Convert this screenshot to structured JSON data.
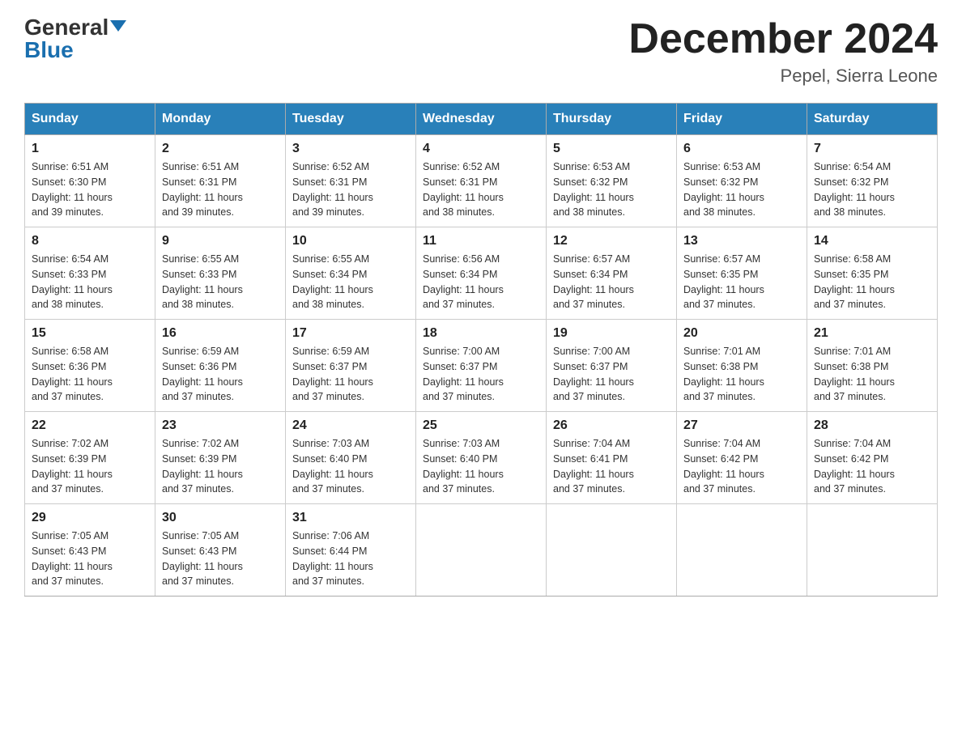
{
  "header": {
    "logo_general": "General",
    "logo_blue": "Blue",
    "title": "December 2024",
    "subtitle": "Pepel, Sierra Leone"
  },
  "days_of_week": [
    "Sunday",
    "Monday",
    "Tuesday",
    "Wednesday",
    "Thursday",
    "Friday",
    "Saturday"
  ],
  "weeks": [
    [
      {
        "day": "1",
        "sunrise": "6:51 AM",
        "sunset": "6:30 PM",
        "daylight": "11 hours and 39 minutes."
      },
      {
        "day": "2",
        "sunrise": "6:51 AM",
        "sunset": "6:31 PM",
        "daylight": "11 hours and 39 minutes."
      },
      {
        "day": "3",
        "sunrise": "6:52 AM",
        "sunset": "6:31 PM",
        "daylight": "11 hours and 39 minutes."
      },
      {
        "day": "4",
        "sunrise": "6:52 AM",
        "sunset": "6:31 PM",
        "daylight": "11 hours and 38 minutes."
      },
      {
        "day": "5",
        "sunrise": "6:53 AM",
        "sunset": "6:32 PM",
        "daylight": "11 hours and 38 minutes."
      },
      {
        "day": "6",
        "sunrise": "6:53 AM",
        "sunset": "6:32 PM",
        "daylight": "11 hours and 38 minutes."
      },
      {
        "day": "7",
        "sunrise": "6:54 AM",
        "sunset": "6:32 PM",
        "daylight": "11 hours and 38 minutes."
      }
    ],
    [
      {
        "day": "8",
        "sunrise": "6:54 AM",
        "sunset": "6:33 PM",
        "daylight": "11 hours and 38 minutes."
      },
      {
        "day": "9",
        "sunrise": "6:55 AM",
        "sunset": "6:33 PM",
        "daylight": "11 hours and 38 minutes."
      },
      {
        "day": "10",
        "sunrise": "6:55 AM",
        "sunset": "6:34 PM",
        "daylight": "11 hours and 38 minutes."
      },
      {
        "day": "11",
        "sunrise": "6:56 AM",
        "sunset": "6:34 PM",
        "daylight": "11 hours and 37 minutes."
      },
      {
        "day": "12",
        "sunrise": "6:57 AM",
        "sunset": "6:34 PM",
        "daylight": "11 hours and 37 minutes."
      },
      {
        "day": "13",
        "sunrise": "6:57 AM",
        "sunset": "6:35 PM",
        "daylight": "11 hours and 37 minutes."
      },
      {
        "day": "14",
        "sunrise": "6:58 AM",
        "sunset": "6:35 PM",
        "daylight": "11 hours and 37 minutes."
      }
    ],
    [
      {
        "day": "15",
        "sunrise": "6:58 AM",
        "sunset": "6:36 PM",
        "daylight": "11 hours and 37 minutes."
      },
      {
        "day": "16",
        "sunrise": "6:59 AM",
        "sunset": "6:36 PM",
        "daylight": "11 hours and 37 minutes."
      },
      {
        "day": "17",
        "sunrise": "6:59 AM",
        "sunset": "6:37 PM",
        "daylight": "11 hours and 37 minutes."
      },
      {
        "day": "18",
        "sunrise": "7:00 AM",
        "sunset": "6:37 PM",
        "daylight": "11 hours and 37 minutes."
      },
      {
        "day": "19",
        "sunrise": "7:00 AM",
        "sunset": "6:37 PM",
        "daylight": "11 hours and 37 minutes."
      },
      {
        "day": "20",
        "sunrise": "7:01 AM",
        "sunset": "6:38 PM",
        "daylight": "11 hours and 37 minutes."
      },
      {
        "day": "21",
        "sunrise": "7:01 AM",
        "sunset": "6:38 PM",
        "daylight": "11 hours and 37 minutes."
      }
    ],
    [
      {
        "day": "22",
        "sunrise": "7:02 AM",
        "sunset": "6:39 PM",
        "daylight": "11 hours and 37 minutes."
      },
      {
        "day": "23",
        "sunrise": "7:02 AM",
        "sunset": "6:39 PM",
        "daylight": "11 hours and 37 minutes."
      },
      {
        "day": "24",
        "sunrise": "7:03 AM",
        "sunset": "6:40 PM",
        "daylight": "11 hours and 37 minutes."
      },
      {
        "day": "25",
        "sunrise": "7:03 AM",
        "sunset": "6:40 PM",
        "daylight": "11 hours and 37 minutes."
      },
      {
        "day": "26",
        "sunrise": "7:04 AM",
        "sunset": "6:41 PM",
        "daylight": "11 hours and 37 minutes."
      },
      {
        "day": "27",
        "sunrise": "7:04 AM",
        "sunset": "6:42 PM",
        "daylight": "11 hours and 37 minutes."
      },
      {
        "day": "28",
        "sunrise": "7:04 AM",
        "sunset": "6:42 PM",
        "daylight": "11 hours and 37 minutes."
      }
    ],
    [
      {
        "day": "29",
        "sunrise": "7:05 AM",
        "sunset": "6:43 PM",
        "daylight": "11 hours and 37 minutes."
      },
      {
        "day": "30",
        "sunrise": "7:05 AM",
        "sunset": "6:43 PM",
        "daylight": "11 hours and 37 minutes."
      },
      {
        "day": "31",
        "sunrise": "7:06 AM",
        "sunset": "6:44 PM",
        "daylight": "11 hours and 37 minutes."
      },
      null,
      null,
      null,
      null
    ]
  ],
  "labels": {
    "sunrise": "Sunrise:",
    "sunset": "Sunset:",
    "daylight": "Daylight:"
  }
}
